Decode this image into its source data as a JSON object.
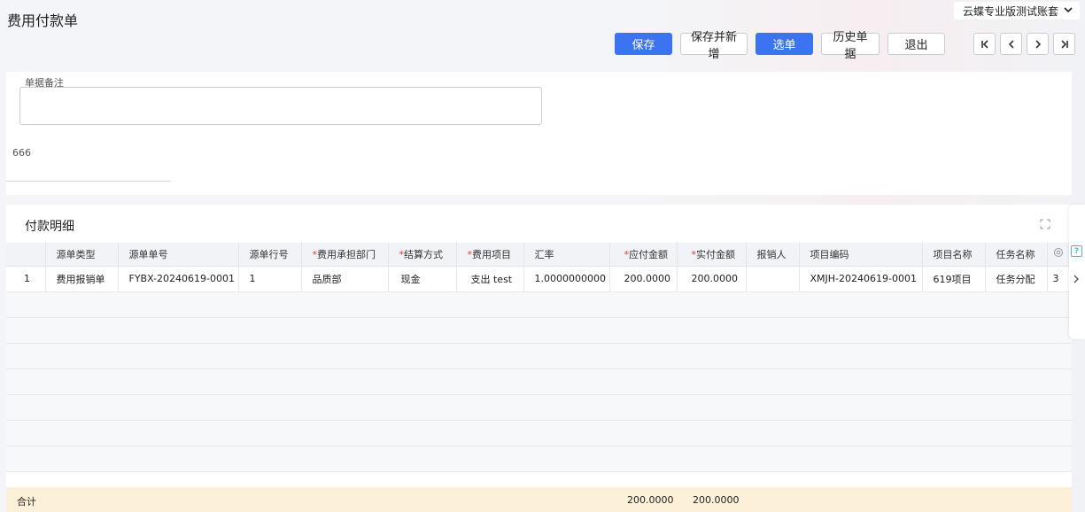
{
  "header": {
    "title": "费用付款单",
    "account": "云蝶专业版测试账套"
  },
  "toolbar": {
    "save": "保存",
    "save_new": "保存并新增",
    "select": "选单",
    "history": "历史单据",
    "exit": "退出"
  },
  "remark": {
    "label": "单据备注",
    "value": "",
    "extra_value": "666"
  },
  "detail": {
    "title": "付款明细",
    "columns": [
      "",
      "源单类型",
      "源单单号",
      "源单行号",
      "费用承担部门",
      "结算方式",
      "费用项目",
      "汇率",
      "应付金额",
      "实付金额",
      "报销人",
      "项目编码",
      "项目名称",
      "任务名称"
    ],
    "required": [
      "费用承担部门",
      "结算方式",
      "费用项目",
      "应付金额",
      "实付金额"
    ],
    "rows": [
      {
        "index": "1",
        "source_type": "费用报销单",
        "source_no": "FYBX-20240619-0001",
        "source_line": "1",
        "dept": "品质部",
        "settle": "现金",
        "item": "支出 test",
        "rate": "1.0000000000",
        "payable": "200.0000",
        "paid": "200.0000",
        "reimburser": "",
        "project_code": "XMJH-20240619-0001",
        "project_name": "619项目",
        "task_name": "任务分配",
        "overflow": "3"
      }
    ],
    "total_label": "合计",
    "total_payable": "200.0000",
    "total_paid": "200.0000"
  },
  "side": {
    "help": "?"
  }
}
